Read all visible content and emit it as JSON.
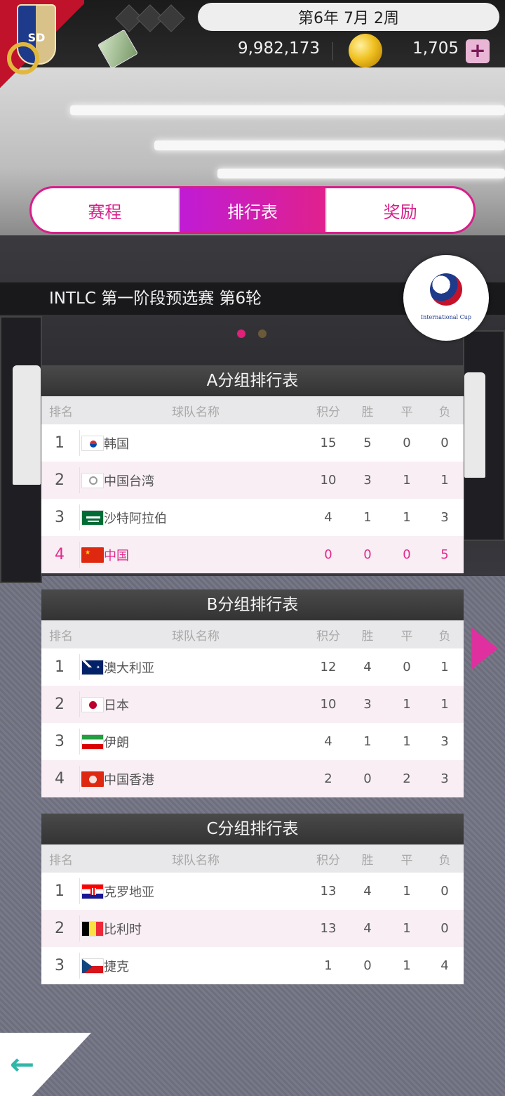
{
  "header": {
    "date": "第6年 7月 2周",
    "money": "9,982,173",
    "coins": "1,705",
    "plus": "+",
    "club_badge_text": "SD"
  },
  "tabs": [
    {
      "label": "赛程",
      "active": false
    },
    {
      "label": "排行表",
      "active": true
    },
    {
      "label": "奖励",
      "active": false
    }
  ],
  "round_title": "INTLC 第一阶段预选赛 第6轮",
  "cup_logo_text": "International Cup",
  "columns": {
    "rank": "排名",
    "team": "球队名称",
    "pts": "积分",
    "w": "胜",
    "d": "平",
    "l": "负"
  },
  "groups": [
    {
      "title": "A分组排行表",
      "rows": [
        {
          "rank": "1",
          "flag": "korea",
          "team": "韩国",
          "pts": "15",
          "w": "5",
          "d": "0",
          "l": "0"
        },
        {
          "rank": "2",
          "flag": "chinese-taipei",
          "team": "中国台湾",
          "pts": "10",
          "w": "3",
          "d": "1",
          "l": "1"
        },
        {
          "rank": "3",
          "flag": "saudi-arabia",
          "team": "沙特阿拉伯",
          "pts": "4",
          "w": "1",
          "d": "1",
          "l": "3"
        },
        {
          "rank": "4",
          "flag": "china",
          "team": "中国",
          "pts": "0",
          "w": "0",
          "d": "0",
          "l": "5",
          "highlight": true
        }
      ]
    },
    {
      "title": "B分组排行表",
      "rows": [
        {
          "rank": "1",
          "flag": "australia",
          "team": "澳大利亚",
          "pts": "12",
          "w": "4",
          "d": "0",
          "l": "1"
        },
        {
          "rank": "2",
          "flag": "japan",
          "team": "日本",
          "pts": "10",
          "w": "3",
          "d": "1",
          "l": "1"
        },
        {
          "rank": "3",
          "flag": "iran",
          "team": "伊朗",
          "pts": "4",
          "w": "1",
          "d": "1",
          "l": "3"
        },
        {
          "rank": "4",
          "flag": "hong-kong",
          "team": "中国香港",
          "pts": "2",
          "w": "0",
          "d": "2",
          "l": "3"
        }
      ]
    },
    {
      "title": "C分组排行表",
      "rows": [
        {
          "rank": "1",
          "flag": "croatia",
          "team": "克罗地亚",
          "pts": "13",
          "w": "4",
          "d": "1",
          "l": "0"
        },
        {
          "rank": "2",
          "flag": "belgium",
          "team": "比利时",
          "pts": "13",
          "w": "4",
          "d": "1",
          "l": "0"
        },
        {
          "rank": "3",
          "flag": "czech",
          "team": "捷克",
          "pts": "1",
          "w": "0",
          "d": "1",
          "l": "4"
        }
      ]
    }
  ],
  "colors": {
    "accent": "#e0208c",
    "tab_active_start": "#c01cd6",
    "back_arrow": "#2fb7a9"
  }
}
